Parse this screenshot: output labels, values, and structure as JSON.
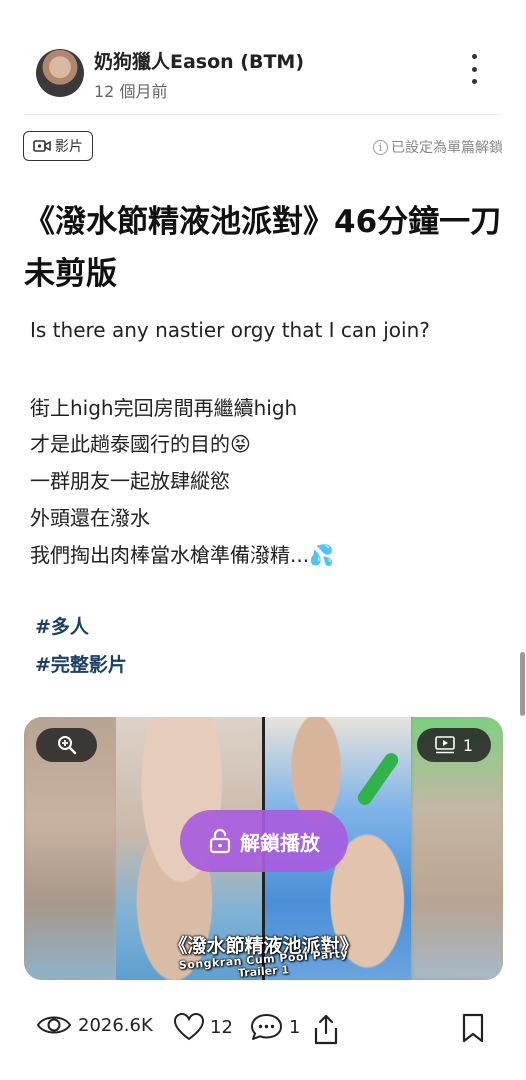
{
  "author": {
    "name": "奶狗獵人Eason (BTM)",
    "time": "12 個月前"
  },
  "post": {
    "type_badge": "影片",
    "unlock_note": "已設定為單篇解鎖",
    "title": "《潑水節精液池派對》46分鐘一刀未剪版",
    "body_lines": [
      "Is there any nastier orgy that I can join?",
      "街上high完回房間再繼續high",
      "才是此趟泰國行的目的😝",
      "一群朋友一起放肆縱慾",
      "外頭還在潑水",
      "我們掏出肉棒當水槍準備潑精...💦"
    ],
    "tags": [
      "#多人",
      "#完整影片"
    ]
  },
  "media": {
    "video_count": "1",
    "unlock_label": "解鎖播放",
    "caption_title": "《潑水節精液池派對》",
    "caption_sub1": "Songkran Cum Pool Party",
    "caption_sub2": "Trailer 1"
  },
  "stats": {
    "views": "2026.6K",
    "likes": "12",
    "comments": "1"
  },
  "icons": {
    "more": "more-vertical-icon",
    "video": "video-camera-icon",
    "info": "info-icon",
    "zoom": "zoom-in-icon",
    "play": "play-list-icon",
    "lock": "unlock-icon",
    "eye": "eye-icon",
    "heart": "heart-icon",
    "comment": "comment-icon",
    "share": "share-icon",
    "bookmark": "bookmark-icon"
  },
  "colors": {
    "tag": "#1d3f66",
    "unlock_button": "#a85cde"
  }
}
